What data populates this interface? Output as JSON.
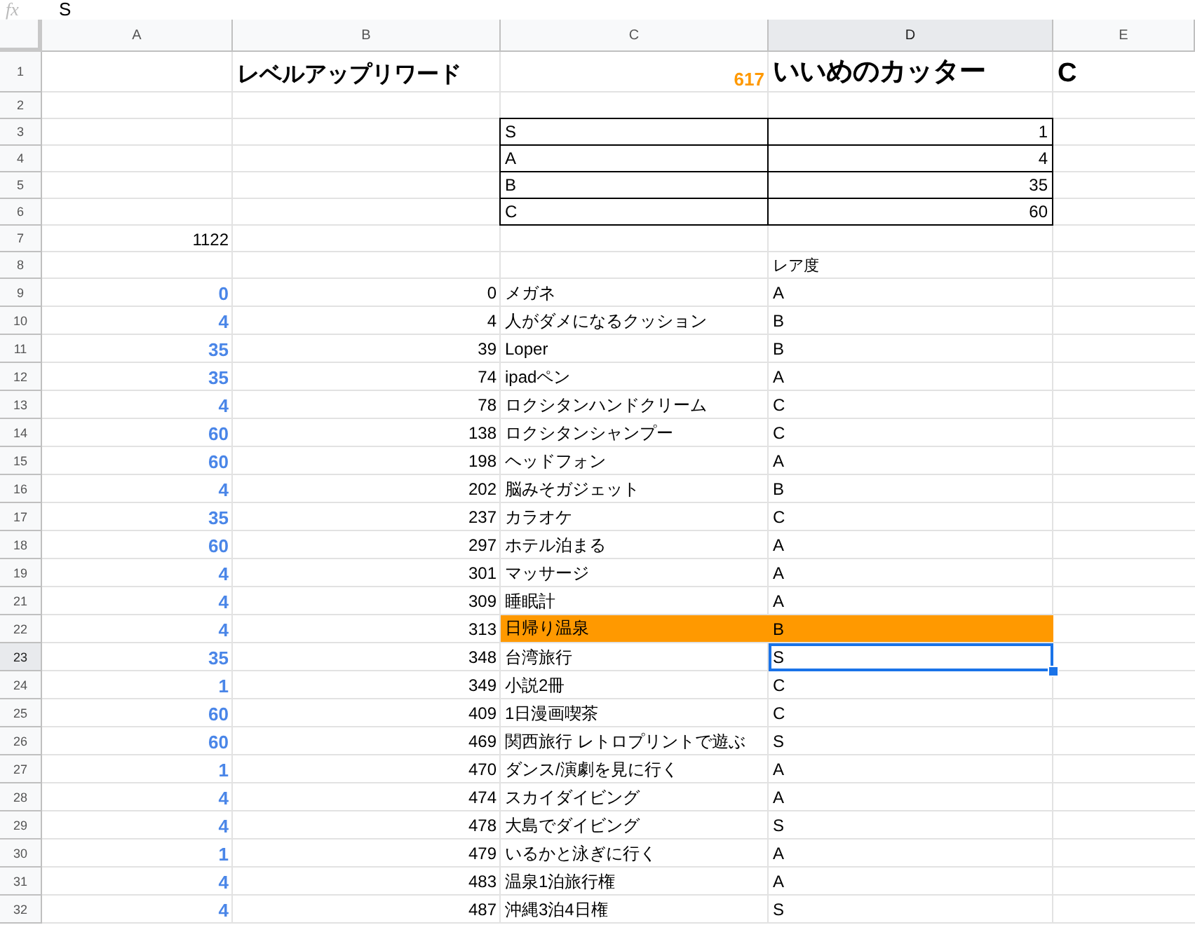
{
  "formula_bar": {
    "label": "fx",
    "value": "S"
  },
  "columns": [
    {
      "label": "A",
      "selected": false
    },
    {
      "label": "B",
      "selected": false
    },
    {
      "label": "C",
      "selected": false
    },
    {
      "label": "D",
      "selected": true
    },
    {
      "label": "E",
      "selected": false
    }
  ],
  "rows": [
    {
      "number": "1",
      "kind": "title",
      "selected": false,
      "highlighted": false,
      "b": "レベルアップリワード",
      "c": "617",
      "d": "いいめのカッター",
      "e": "C"
    },
    {
      "number": "2",
      "kind": "blank",
      "selected": false,
      "highlighted": false
    },
    {
      "number": "3",
      "kind": "table",
      "selected": false,
      "highlighted": false,
      "c": "S",
      "d": "1"
    },
    {
      "number": "4",
      "kind": "table",
      "selected": false,
      "highlighted": false,
      "c": "A",
      "d": "4"
    },
    {
      "number": "5",
      "kind": "table",
      "selected": false,
      "highlighted": false,
      "c": "B",
      "d": "35"
    },
    {
      "number": "6",
      "kind": "table",
      "selected": false,
      "highlighted": false,
      "c": "C",
      "d": "60"
    },
    {
      "number": "7",
      "kind": "plain",
      "selected": false,
      "highlighted": false,
      "a": "1122"
    },
    {
      "number": "8",
      "kind": "plain",
      "selected": false,
      "highlighted": false,
      "d": "レア度"
    },
    {
      "number": "9",
      "kind": "item",
      "selected": false,
      "highlighted": false,
      "a": "0",
      "b": "0",
      "c": "メガネ",
      "d": "A"
    },
    {
      "number": "10",
      "kind": "item",
      "selected": false,
      "highlighted": false,
      "a": "4",
      "b": "4",
      "c": "人がダメになるクッション",
      "d": "B"
    },
    {
      "number": "11",
      "kind": "item",
      "selected": false,
      "highlighted": false,
      "a": "35",
      "b": "39",
      "c": "Loper",
      "d": "B"
    },
    {
      "number": "12",
      "kind": "item",
      "selected": false,
      "highlighted": false,
      "a": "35",
      "b": "74",
      "c": "ipadペン",
      "d": "A"
    },
    {
      "number": "13",
      "kind": "item",
      "selected": false,
      "highlighted": false,
      "a": "4",
      "b": "78",
      "c": "ロクシタンハンドクリーム",
      "d": "C"
    },
    {
      "number": "14",
      "kind": "item",
      "selected": false,
      "highlighted": false,
      "a": "60",
      "b": "138",
      "c": "ロクシタンシャンプー",
      "d": "C"
    },
    {
      "number": "15",
      "kind": "item",
      "selected": false,
      "highlighted": false,
      "a": "60",
      "b": "198",
      "c": "ヘッドフォン",
      "d": "A"
    },
    {
      "number": "16",
      "kind": "item",
      "selected": false,
      "highlighted": false,
      "a": "4",
      "b": "202",
      "c": "脳みそガジェット",
      "d": "B"
    },
    {
      "number": "17",
      "kind": "item",
      "selected": false,
      "highlighted": false,
      "a": "35",
      "b": "237",
      "c": "カラオケ",
      "d": "C"
    },
    {
      "number": "18",
      "kind": "item",
      "selected": false,
      "highlighted": false,
      "a": "60",
      "b": "297",
      "c": "ホテル泊まる",
      "d": "A"
    },
    {
      "number": "19",
      "kind": "item",
      "selected": false,
      "highlighted": false,
      "a": "4",
      "b": "301",
      "c": "マッサージ",
      "d": "A"
    },
    {
      "number": "21",
      "kind": "item",
      "selected": false,
      "highlighted": false,
      "a": "4",
      "b": "309",
      "c": "睡眠計",
      "d": "A"
    },
    {
      "number": "22",
      "kind": "item",
      "selected": false,
      "highlighted": true,
      "a": "4",
      "b": "313",
      "c": "日帰り温泉",
      "d": "B"
    },
    {
      "number": "23",
      "kind": "item",
      "selected": true,
      "highlighted": false,
      "a": "35",
      "b": "348",
      "c": "台湾旅行",
      "d": "S"
    },
    {
      "number": "24",
      "kind": "item",
      "selected": false,
      "highlighted": false,
      "a": "1",
      "b": "349",
      "c": "小説2冊",
      "d": "C"
    },
    {
      "number": "25",
      "kind": "item",
      "selected": false,
      "highlighted": false,
      "a": "60",
      "b": "409",
      "c": "1日漫画喫茶",
      "d": "C"
    },
    {
      "number": "26",
      "kind": "item",
      "selected": false,
      "highlighted": false,
      "a": "60",
      "b": "469",
      "c": "関西旅行 レトロプリントで遊ぶ",
      "d": "S"
    },
    {
      "number": "27",
      "kind": "item",
      "selected": false,
      "highlighted": false,
      "a": "1",
      "b": "470",
      "c": "ダンス/演劇を見に行く",
      "d": "A"
    },
    {
      "number": "28",
      "kind": "item",
      "selected": false,
      "highlighted": false,
      "a": "4",
      "b": "474",
      "c": "スカイダイビング",
      "d": "A"
    },
    {
      "number": "29",
      "kind": "item",
      "selected": false,
      "highlighted": false,
      "a": "4",
      "b": "478",
      "c": "大島でダイビング",
      "d": "S"
    },
    {
      "number": "30",
      "kind": "item",
      "selected": false,
      "highlighted": false,
      "a": "1",
      "b": "479",
      "c": "いるかと泳ぎに行く",
      "d": "A"
    },
    {
      "number": "31",
      "kind": "item",
      "selected": false,
      "highlighted": false,
      "a": "4",
      "b": "483",
      "c": "温泉1泊旅行権",
      "d": "A"
    },
    {
      "number": "32",
      "kind": "item",
      "selected": false,
      "highlighted": false,
      "a": "4",
      "b": "487",
      "c": "沖縄3泊4日権",
      "d": "S"
    }
  ]
}
